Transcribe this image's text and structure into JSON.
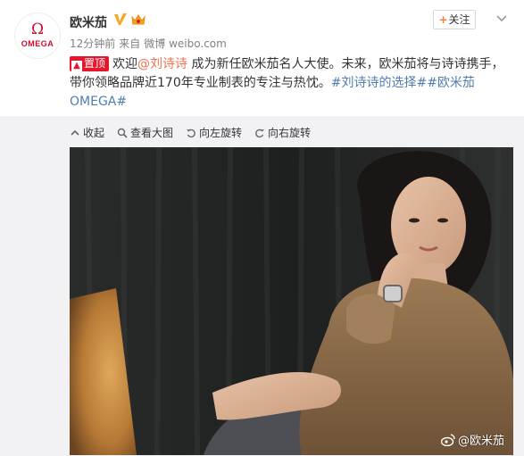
{
  "user": {
    "name": "欧米茄",
    "avatar_symbol": "Ω",
    "avatar_word": "OMEGA",
    "time": "12分钟前",
    "source_prefix": "来自",
    "source": "微博 weibo.com"
  },
  "follow": {
    "plus": "+",
    "label": "关注"
  },
  "post": {
    "pin_label": "置顶",
    "pin_icon": "up-arrow-icon",
    "text_before": "欢迎",
    "mention": "@刘诗诗",
    "text_after": " 成为新任欧米茄名人大使。未来，欧米茄将与诗诗携手，带你领略品牌近170年专业制表的专注与热忱。",
    "topic1": "#刘诗诗的选择#",
    "topic2": "#欧米茄OMEGA#"
  },
  "media_tools": [
    {
      "label": "收起",
      "icon": "collapse-icon"
    },
    {
      "label": "查看大图",
      "icon": "zoom-icon"
    },
    {
      "label": "向左旋转",
      "icon": "rotate-left-icon"
    },
    {
      "label": "向右旋转",
      "icon": "rotate-right-icon"
    }
  ],
  "watermark": "@欧米茄",
  "colors": {
    "brand_red": "#c8102e",
    "link_orange": "#eb7350",
    "topic_blue": "#507daf",
    "pin_red": "#e6162d"
  }
}
